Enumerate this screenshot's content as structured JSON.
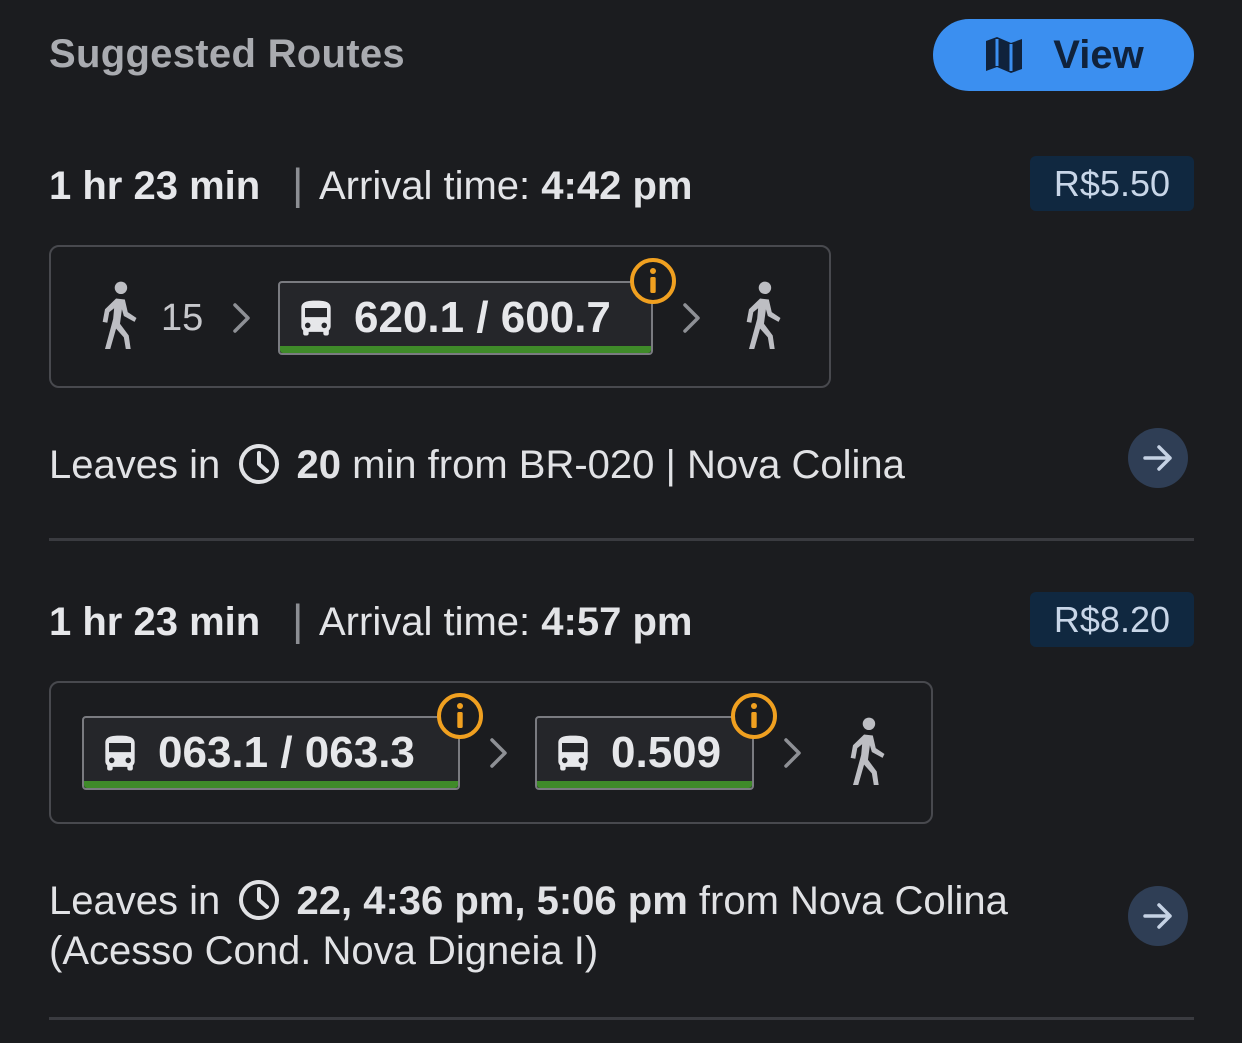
{
  "header": {
    "title": "Suggested Routes",
    "view_label": "View"
  },
  "routes": [
    {
      "duration": "1 hr 23 min",
      "separator": "|",
      "arrival_label": "Arrival time:",
      "arrival_time": "4:42 pm",
      "fare": "R$5.50",
      "legs": [
        {
          "kind": "walk",
          "minutes": "15"
        },
        {
          "kind": "bus",
          "label": "620.1 / 600.7",
          "has_info": true
        },
        {
          "kind": "walk"
        }
      ],
      "leaves_prefix": "Leaves in",
      "leaves_time": "20",
      "leaves_suffix": " min from BR-020 | Nova Colina"
    },
    {
      "duration": "1 hr 23 min",
      "separator": "|",
      "arrival_label": "Arrival time:",
      "arrival_time": "4:57 pm",
      "fare": "R$8.20",
      "legs": [
        {
          "kind": "bus",
          "label": "063.1 / 063.3",
          "has_info": true
        },
        {
          "kind": "bus",
          "label": "0.509",
          "has_info": true
        },
        {
          "kind": "walk"
        }
      ],
      "leaves_prefix": "Leaves in",
      "leaves_time": "22, 4:36 pm, 5:06 pm",
      "leaves_suffix": " from Nova Colina",
      "leaves_line2": "(Acesso Cond. Nova Digneia I)"
    }
  ],
  "colors": {
    "background": "#1b1c1f",
    "accent": "#3b8ff0",
    "route_line": "#3f8a29",
    "info": "#f0a020"
  }
}
